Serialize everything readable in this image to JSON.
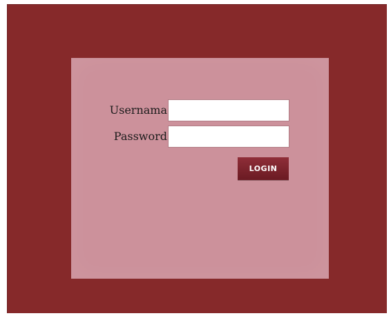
{
  "login_form": {
    "username_label": "Usernama",
    "username_value": "",
    "password_label": "Password",
    "password_value": "",
    "login_button_label": "LOGIN"
  },
  "colors": {
    "frame_background": "#86292a",
    "panel_background": "#cc919b",
    "button_background": "#7a2129"
  }
}
